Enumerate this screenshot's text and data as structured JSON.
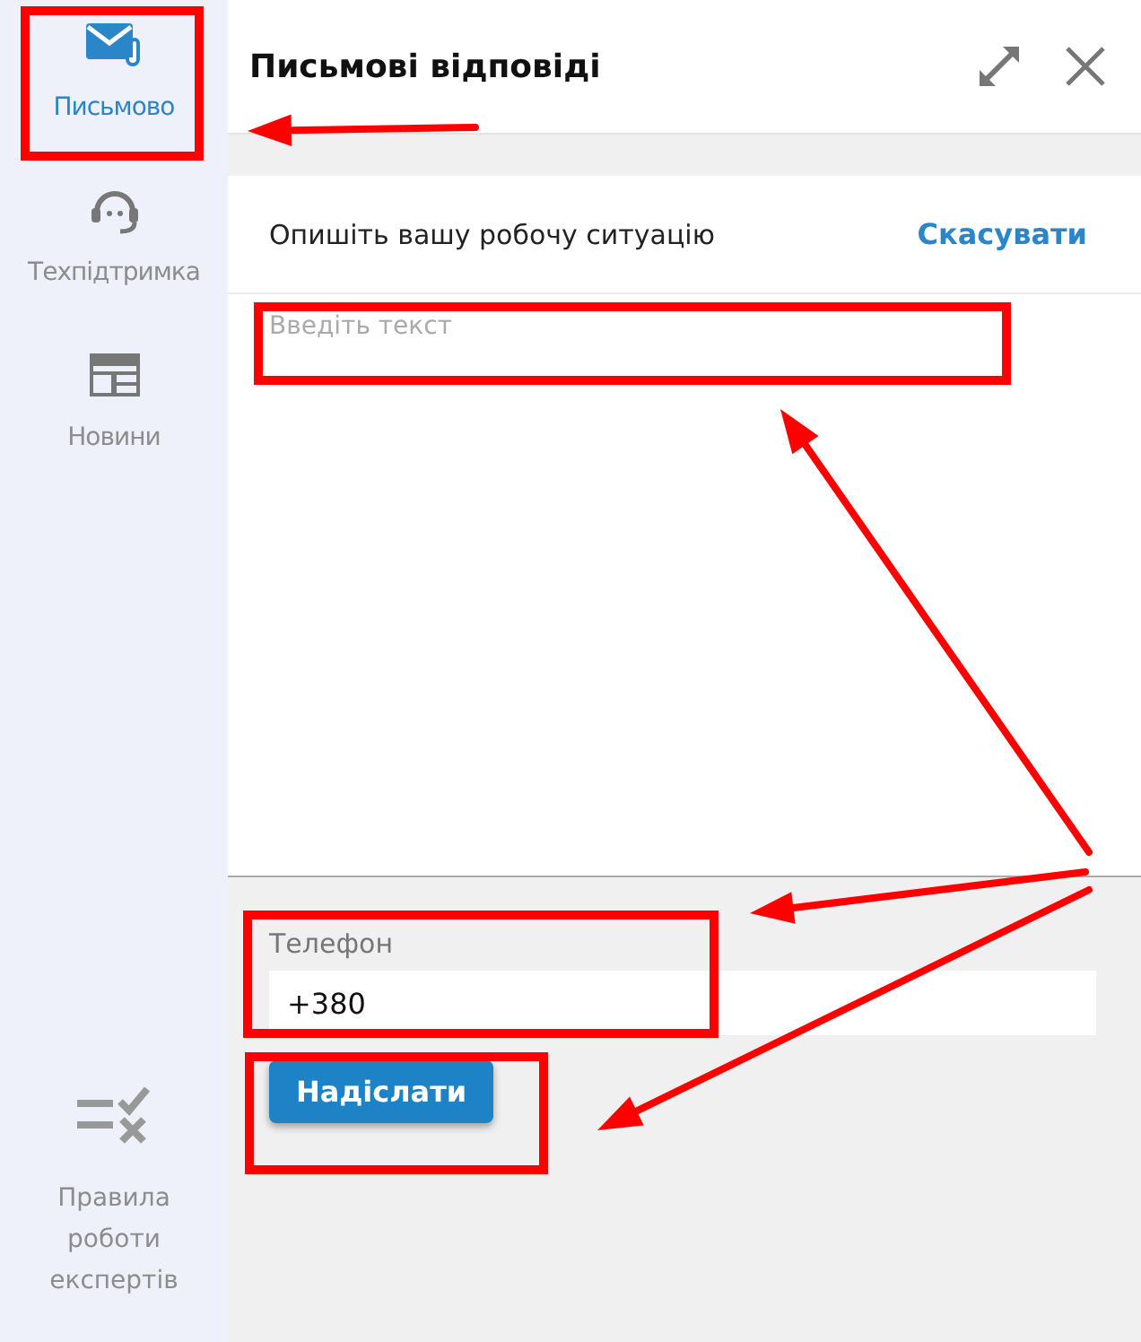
{
  "sidebar": {
    "items": [
      {
        "kind": "mail",
        "label": "Письмово",
        "selected": true
      },
      {
        "kind": "support",
        "label": "Техпідтримка",
        "selected": false
      },
      {
        "kind": "news",
        "label": "Новини",
        "selected": false
      }
    ],
    "footer_item": {
      "kind": "rules",
      "label": "Правила роботи експертів"
    }
  },
  "panel": {
    "title": "Письмові відповіді",
    "prompt": "Опишіть вашу робочу ситуацію",
    "cancel": "Скасувати",
    "message": {
      "placeholder": "Введіть текст"
    },
    "phone": {
      "label": "Телефон",
      "value": "+380"
    },
    "submit": "Надіслати"
  }
}
